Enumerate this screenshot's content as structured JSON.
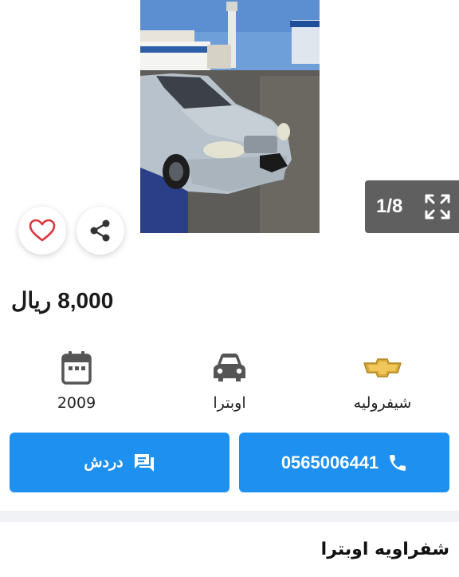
{
  "gallery": {
    "counter": "1/8"
  },
  "listing": {
    "price_value": "8,000",
    "price_currency": "ريال",
    "title": "شفراويه اوبترا"
  },
  "specs": {
    "year": "2009",
    "model": "اوبترا",
    "make": "شيفروليه"
  },
  "actions": {
    "chat_label": "دردش",
    "phone_label": "0565006441"
  },
  "colors": {
    "accent": "#1e90f0",
    "heart": "#d9363e",
    "counter_bg": "#5f5f5f"
  }
}
